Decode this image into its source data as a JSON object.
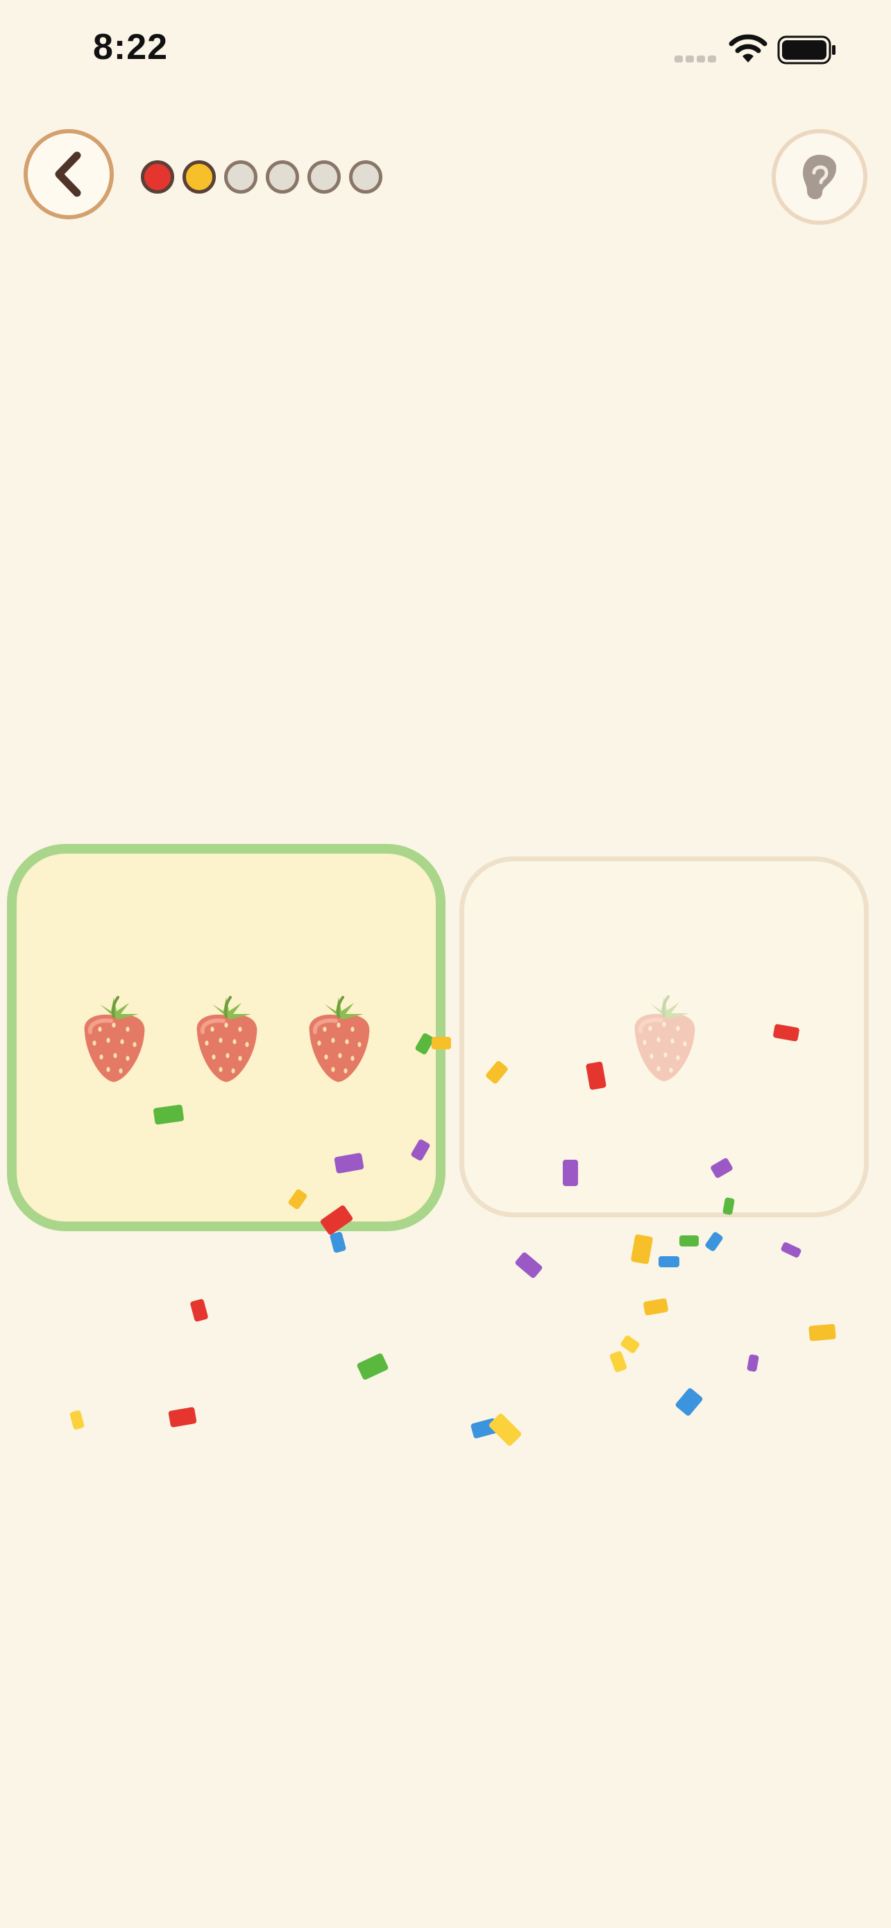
{
  "status_bar": {
    "time": "8:22"
  },
  "progress": {
    "dots": [
      {
        "state": "done",
        "color": "#e4362f"
      },
      {
        "state": "done",
        "color": "#f7c02a"
      },
      {
        "state": "pending",
        "color": "#e2ddd2"
      },
      {
        "state": "pending",
        "color": "#e2ddd2"
      },
      {
        "state": "pending",
        "color": "#e2ddd2"
      },
      {
        "state": "pending",
        "color": "#e2ddd2"
      }
    ]
  },
  "icons": {
    "back": "chevron-left-icon",
    "listen": "ear-icon",
    "item": "strawberry"
  },
  "cards": [
    {
      "count": 3,
      "selected": true,
      "correct": true
    },
    {
      "count": 1,
      "selected": false,
      "faded": true
    }
  ],
  "colors": {
    "background": "#faf5e6",
    "correct_border": "#a9d68a",
    "confetti": [
      "#e4362f",
      "#f7c02a",
      "#5bb83e",
      "#9b59c6",
      "#3b94dd",
      "#fbd23c"
    ]
  }
}
